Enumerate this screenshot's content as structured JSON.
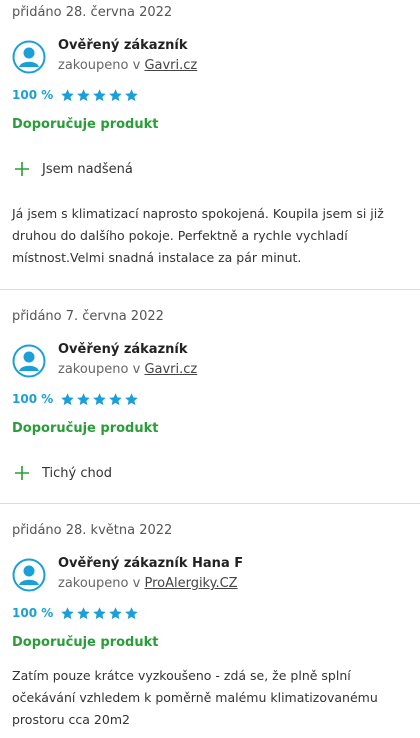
{
  "reviews": [
    {
      "date": "přidáno 28. června 2022",
      "author": "Ověřený zákazník",
      "bought_prefix": "zakoupeno v ",
      "shop": "Gavri.cz",
      "percent": "100 %",
      "stars": 5,
      "recommend": "Doporučuje produkt",
      "pro": "Jsem nadšená",
      "text": "Já jsem s klimatizací naprosto spokojená. Koupila jsem si již druhou do dalšího pokoje. Perfektně a rychle vychladí místnost.Velmi snadná instalace za pár minut."
    },
    {
      "date": "přidáno 7. června 2022",
      "author": "Ověřený zákazník",
      "bought_prefix": "zakoupeno v ",
      "shop": "Gavri.cz",
      "percent": "100 %",
      "stars": 5,
      "recommend": "Doporučuje produkt",
      "pro": "Tichý chod"
    },
    {
      "date": "přidáno 28. května 2022",
      "author": "Ověřený zákazník Hana F",
      "bought_prefix": "zakoupeno v ",
      "shop": "ProAlergiky.CZ",
      "percent": "100 %",
      "stars": 5,
      "recommend": "Doporučuje produkt",
      "text": "Zatím pouze krátce vyzkoušeno - zdá se, že plně splní očekávání vzhledem k poměrně malému klimatizovanému prostoru cca 20m2"
    }
  ],
  "colors": {
    "accent_blue": "#1a9fd6",
    "recommend_green": "#2a9d3a",
    "star_blue": "#1a9fd6"
  },
  "icons": {
    "avatar": "user-avatar-icon",
    "star": "star-icon",
    "plus": "plus-icon"
  }
}
